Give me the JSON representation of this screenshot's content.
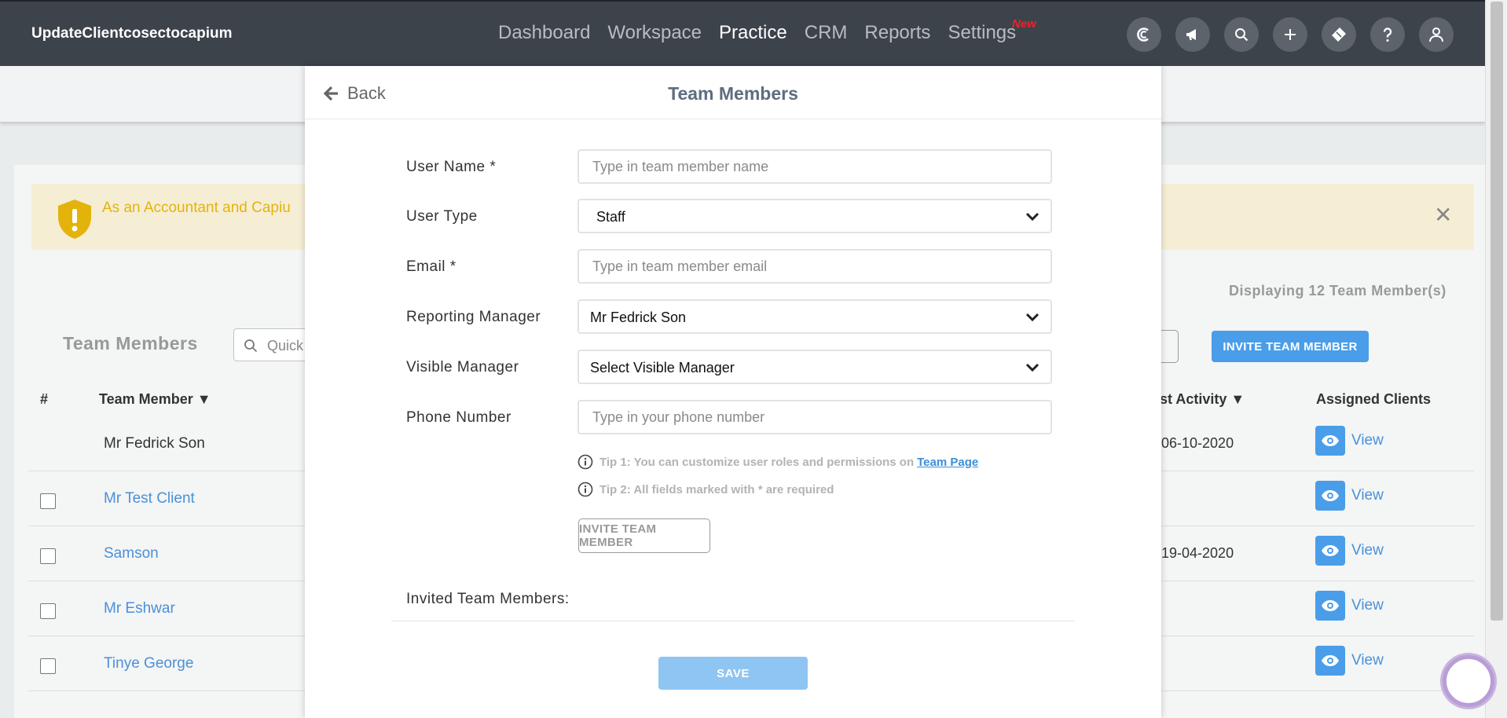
{
  "app": {
    "brand": "UpdateClientcosectocapium",
    "nav": [
      {
        "label": "Dashboard",
        "active": false
      },
      {
        "label": "Workspace",
        "active": false
      },
      {
        "label": "Practice",
        "active": true
      },
      {
        "label": "CRM",
        "active": false
      },
      {
        "label": "Reports",
        "active": false
      },
      {
        "label": "Settings",
        "active": false
      }
    ],
    "new_badge": "New",
    "icons": [
      "capium-logo-icon",
      "megaphone-icon",
      "search-icon",
      "plus-icon",
      "ticket-icon",
      "help-icon",
      "user-icon"
    ]
  },
  "background": {
    "alert_text": "As an Accountant and Capiu",
    "displaying": "Displaying 12 Team Member(s)",
    "section_title": "Team Members",
    "search_placeholder": "Quick",
    "invite_button": "INVITE TEAM MEMBER",
    "columns": {
      "number": "#",
      "member": "Team Member ▼",
      "last_activity": "ast Activity ▼",
      "assigned": "Assigned Clients"
    },
    "rows": [
      {
        "name": "Mr Fedrick Son",
        "date": "06-10-2020",
        "checkbox": false,
        "link": false
      },
      {
        "name": "Mr Test Client",
        "date": "",
        "checkbox": true,
        "link": true
      },
      {
        "name": "Samson",
        "date": "19-04-2020",
        "checkbox": true,
        "link": true
      },
      {
        "name": "Mr Eshwar",
        "date": "",
        "checkbox": true,
        "link": true
      },
      {
        "name": "Tinye George",
        "date": "",
        "checkbox": true,
        "link": true
      }
    ],
    "view_label": "View"
  },
  "modal": {
    "back_label": "Back",
    "title": "Team Members",
    "fields": {
      "username": {
        "label": "User Name *",
        "placeholder": "Type in team member name",
        "value": ""
      },
      "user_type": {
        "label": "User Type",
        "value": "Staff"
      },
      "email": {
        "label": "Email *",
        "placeholder": "Type in team member email",
        "value": ""
      },
      "reporting_manager": {
        "label": "Reporting Manager",
        "value": "Mr Fedrick Son"
      },
      "visible_manager": {
        "label": "Visible Manager",
        "value": "Select Visible Manager"
      },
      "phone": {
        "label": "Phone Number",
        "placeholder": "Type in your phone number",
        "value": ""
      }
    },
    "tip1": "Tip 1: You can customize user roles and permissions on",
    "tip1_link": "Team Page",
    "tip2": "Tip 2: All fields marked with * are required",
    "invite_button": "INVITE TEAM MEMBER",
    "invited_label": "Invited Team Members:",
    "save_button": "SAVE"
  }
}
